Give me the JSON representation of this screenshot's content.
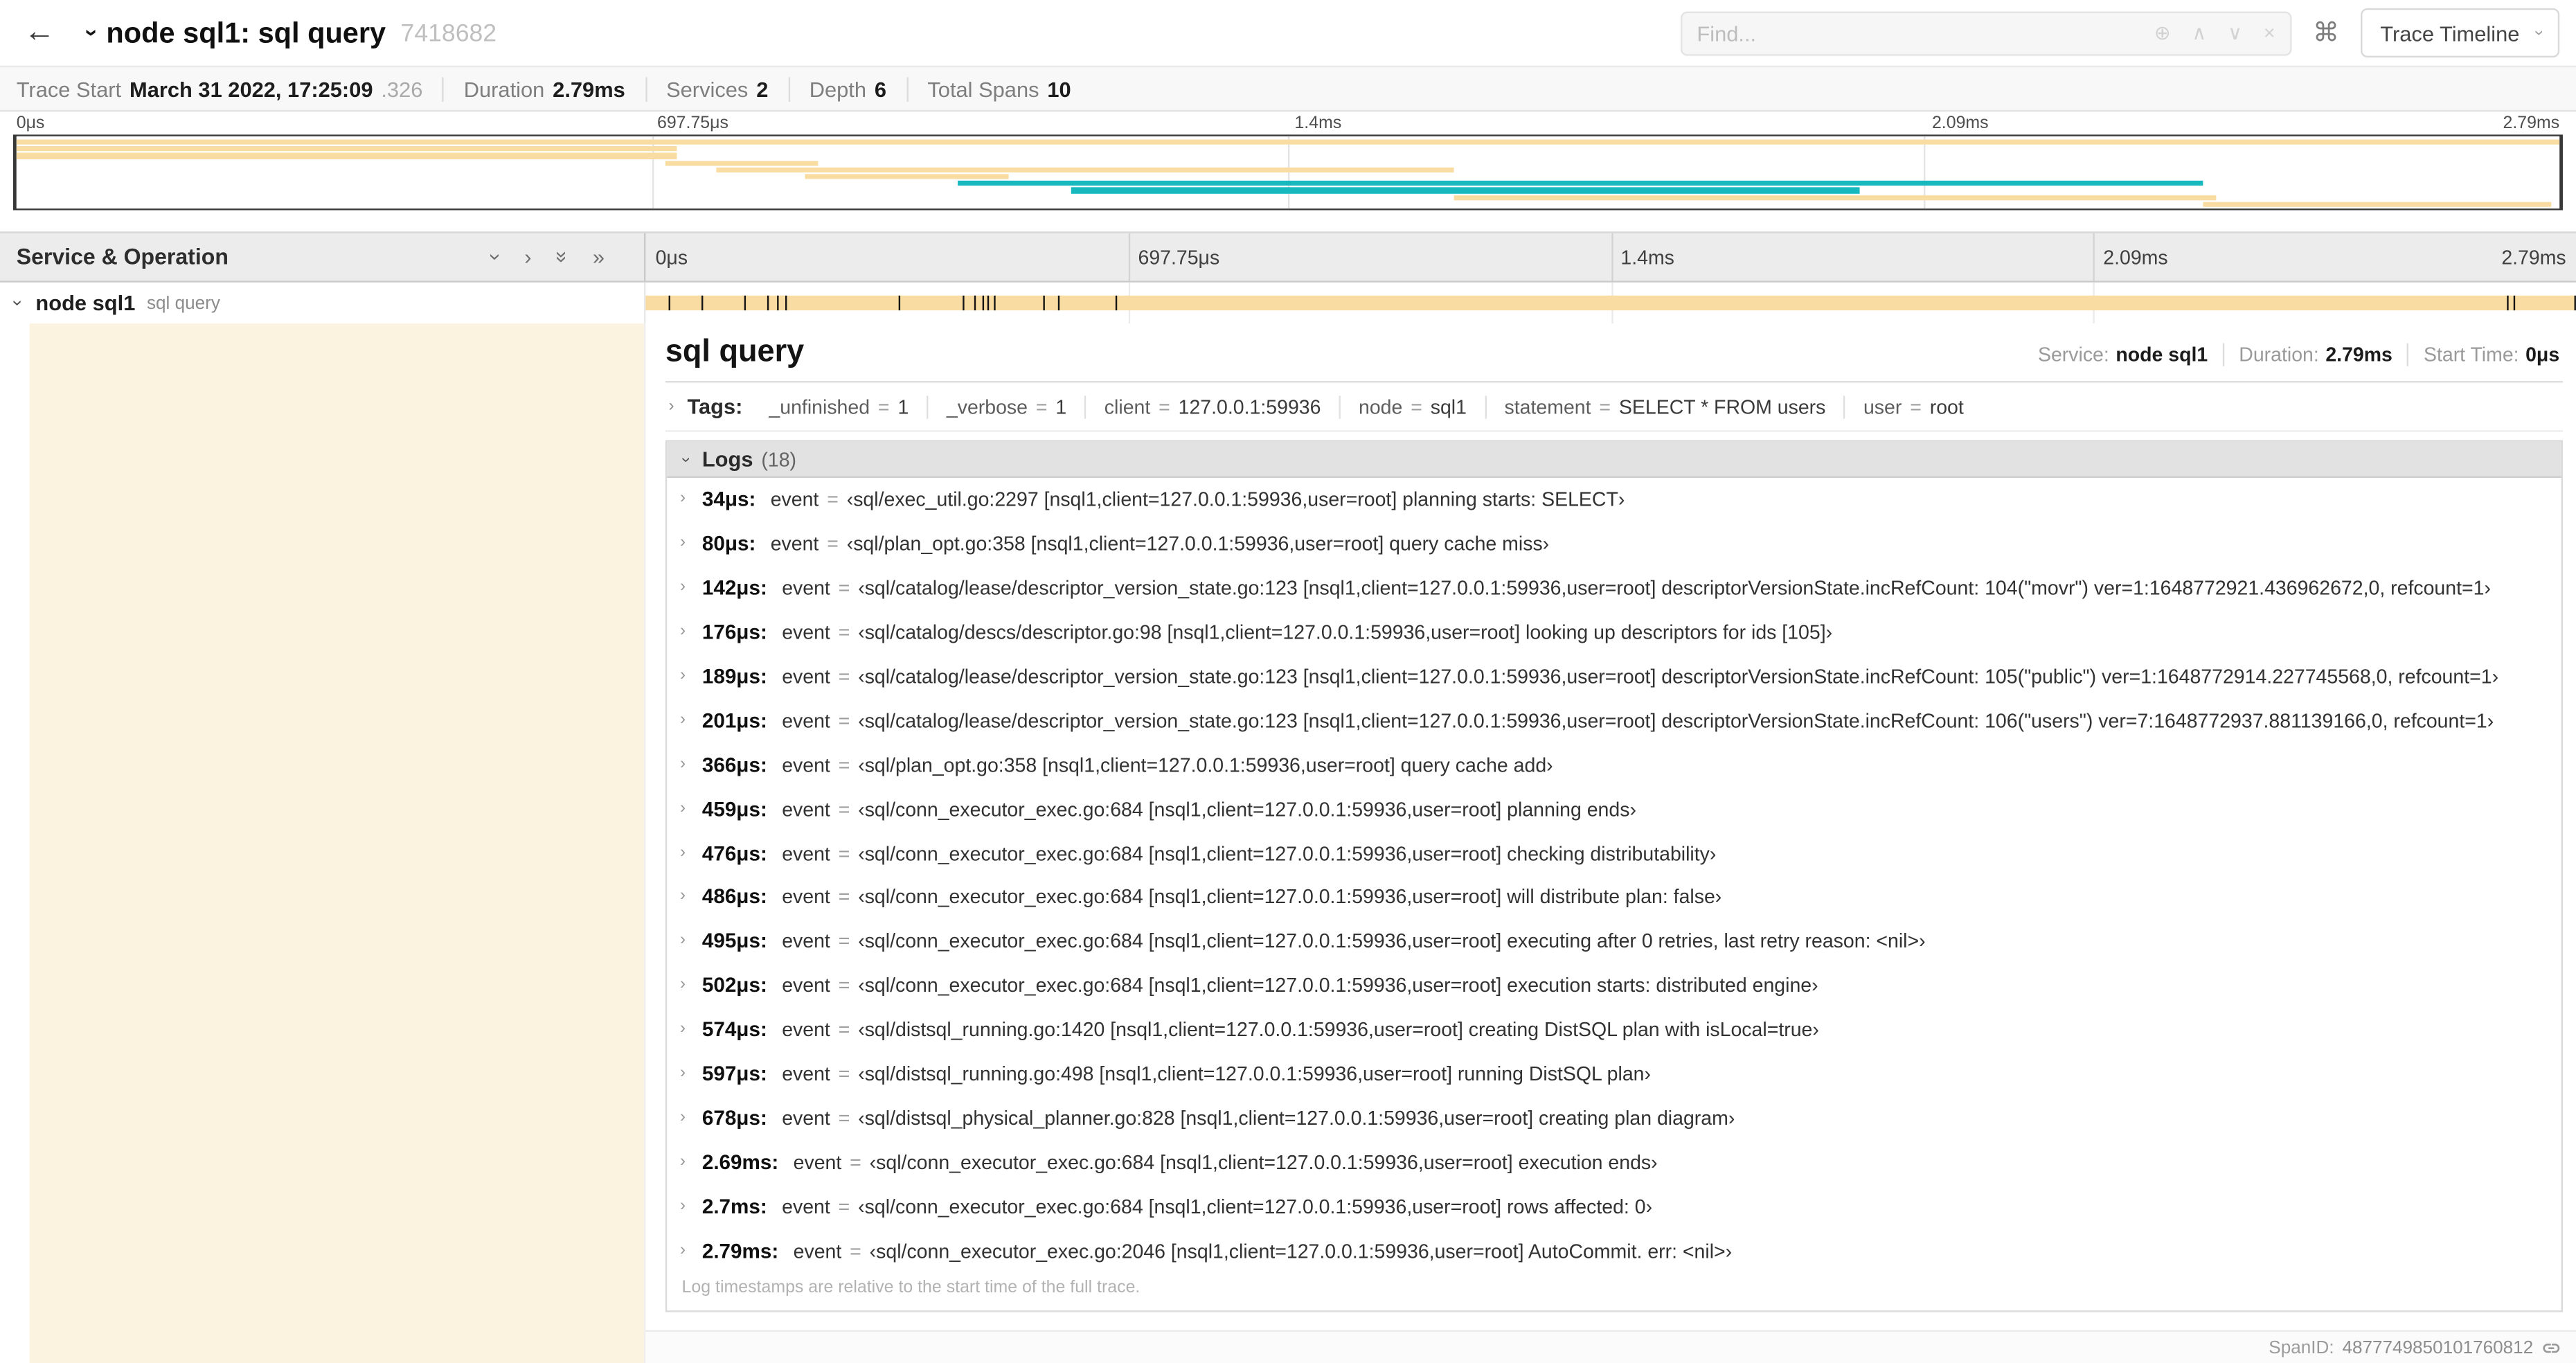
{
  "colors": {
    "span_tan": "#F8DCA1",
    "span_teal": "#17B8BE",
    "selected_tint": "#FBF3DF"
  },
  "icons": {
    "back": "←",
    "chevron": "›",
    "double_chevron": "»",
    "command": "⌘",
    "circle_plus": "⊕",
    "caret_up": "∧",
    "caret_down": "∨",
    "clear": "×"
  },
  "header": {
    "title": "node sql1: sql query",
    "trace_id": "7418682",
    "find_placeholder": "Find...",
    "view_select_label": "Trace Timeline"
  },
  "summary": {
    "trace_start_label": "Trace Start",
    "trace_start_value": "March 31 2022, 17:25:09",
    "trace_start_ms": ".326",
    "duration_label": "Duration",
    "duration_value": "2.79ms",
    "services_label": "Services",
    "services_value": "2",
    "depth_label": "Depth",
    "depth_value": "6",
    "spans_label": "Total Spans",
    "spans_value": "10"
  },
  "minimap": {
    "ticks": [
      "0μs",
      "697.75μs",
      "1.4ms",
      "2.09ms",
      "2.79ms"
    ],
    "spans": [
      {
        "row": 0,
        "start": 0,
        "width": 100,
        "color": "span_tan"
      },
      {
        "row": 1,
        "start": 0,
        "width": 26,
        "color": "span_tan"
      },
      {
        "row": 2,
        "start": 0,
        "width": 26,
        "color": "span_tan"
      },
      {
        "row": 3,
        "start": 25.5,
        "width": 6,
        "color": "span_tan"
      },
      {
        "row": 4,
        "start": 27.5,
        "width": 29,
        "color": "span_tan"
      },
      {
        "row": 5,
        "start": 31,
        "width": 8,
        "color": "span_tan"
      },
      {
        "row": 6,
        "start": 37,
        "width": 49,
        "color": "span_teal"
      },
      {
        "row": 7,
        "start": 41.5,
        "width": 31,
        "color": "span_teal"
      },
      {
        "row": 8,
        "start": 56.5,
        "width": 30,
        "color": "span_tan"
      },
      {
        "row": 9,
        "start": 86,
        "width": 13.7,
        "color": "span_tan"
      }
    ]
  },
  "timeline": {
    "left_header": "Service & Operation",
    "ticks": [
      "0μs",
      "697.75μs",
      "1.4ms",
      "2.09ms",
      "2.79ms"
    ],
    "row": {
      "service": "node sql1",
      "operation": "sql query"
    },
    "span_ticks_pct": [
      1.22,
      2.87,
      5.09,
      6.31,
      6.77,
      7.2,
      13.12,
      16.45,
      17.06,
      17.42,
      17.74,
      18.0,
      20.57,
      21.4,
      24.3,
      96.42,
      96.77,
      99.9
    ]
  },
  "detail": {
    "title": "sql query",
    "eq_sign": "=",
    "stats": [
      {
        "label": "Service:",
        "value": "node sql1"
      },
      {
        "label": "Duration:",
        "value": "2.79ms"
      },
      {
        "label": "Start Time:",
        "value": "0μs"
      }
    ],
    "tags_label": "Tags:",
    "tags": [
      {
        "key": "_unfinished",
        "value": "1"
      },
      {
        "key": "_verbose",
        "value": "1"
      },
      {
        "key": "client",
        "value": "127.0.0.1:59936"
      },
      {
        "key": "node",
        "value": "sql1"
      },
      {
        "key": "statement",
        "value": "SELECT * FROM users"
      },
      {
        "key": "user",
        "value": "root"
      }
    ],
    "logs_label": "Logs",
    "logs_count": "(18)",
    "log_field_key": "event",
    "logs": [
      {
        "time": "34μs:",
        "value": "‹sql/exec_util.go:2297 [nsql1,client=127.0.0.1:59936,user=root] planning starts: SELECT›"
      },
      {
        "time": "80μs:",
        "value": "‹sql/plan_opt.go:358 [nsql1,client=127.0.0.1:59936,user=root] query cache miss›"
      },
      {
        "time": "142μs:",
        "value": "‹sql/catalog/lease/descriptor_version_state.go:123 [nsql1,client=127.0.0.1:59936,user=root] descriptorVersionState.incRefCount: 104(\"movr\") ver=1:1648772921.436962672,0, refcount=1›"
      },
      {
        "time": "176μs:",
        "value": "‹sql/catalog/descs/descriptor.go:98 [nsql1,client=127.0.0.1:59936,user=root] looking up descriptors for ids [105]›"
      },
      {
        "time": "189μs:",
        "value": "‹sql/catalog/lease/descriptor_version_state.go:123 [nsql1,client=127.0.0.1:59936,user=root] descriptorVersionState.incRefCount: 105(\"public\") ver=1:1648772914.227745568,0, refcount=1›"
      },
      {
        "time": "201μs:",
        "value": "‹sql/catalog/lease/descriptor_version_state.go:123 [nsql1,client=127.0.0.1:59936,user=root] descriptorVersionState.incRefCount: 106(\"users\") ver=7:1648772937.881139166,0, refcount=1›"
      },
      {
        "time": "366μs:",
        "value": "‹sql/plan_opt.go:358 [nsql1,client=127.0.0.1:59936,user=root] query cache add›"
      },
      {
        "time": "459μs:",
        "value": "‹sql/conn_executor_exec.go:684 [nsql1,client=127.0.0.1:59936,user=root] planning ends›"
      },
      {
        "time": "476μs:",
        "value": "‹sql/conn_executor_exec.go:684 [nsql1,client=127.0.0.1:59936,user=root] checking distributability›"
      },
      {
        "time": "486μs:",
        "value": "‹sql/conn_executor_exec.go:684 [nsql1,client=127.0.0.1:59936,user=root] will distribute plan: false›"
      },
      {
        "time": "495μs:",
        "value": "‹sql/conn_executor_exec.go:684 [nsql1,client=127.0.0.1:59936,user=root] executing after 0 retries, last retry reason: <nil>›"
      },
      {
        "time": "502μs:",
        "value": "‹sql/conn_executor_exec.go:684 [nsql1,client=127.0.0.1:59936,user=root] execution starts: distributed engine›"
      },
      {
        "time": "574μs:",
        "value": "‹sql/distsql_running.go:1420 [nsql1,client=127.0.0.1:59936,user=root] creating DistSQL plan with isLocal=true›"
      },
      {
        "time": "597μs:",
        "value": "‹sql/distsql_running.go:498 [nsql1,client=127.0.0.1:59936,user=root] running DistSQL plan›"
      },
      {
        "time": "678μs:",
        "value": "‹sql/distsql_physical_planner.go:828 [nsql1,client=127.0.0.1:59936,user=root] creating plan diagram›"
      },
      {
        "time": "2.69ms:",
        "value": "‹sql/conn_executor_exec.go:684 [nsql1,client=127.0.0.1:59936,user=root] execution ends›"
      },
      {
        "time": "2.7ms:",
        "value": "‹sql/conn_executor_exec.go:684 [nsql1,client=127.0.0.1:59936,user=root] rows affected: 0›"
      },
      {
        "time": "2.79ms:",
        "value": "‹sql/conn_executor_exec.go:2046 [nsql1,client=127.0.0.1:59936,user=root] AutoCommit. err: <nil>›"
      }
    ],
    "logs_footer": "Log timestamps are relative to the start time of the full trace.",
    "span_id_label": "SpanID:",
    "span_id": "4877749850101760812"
  }
}
